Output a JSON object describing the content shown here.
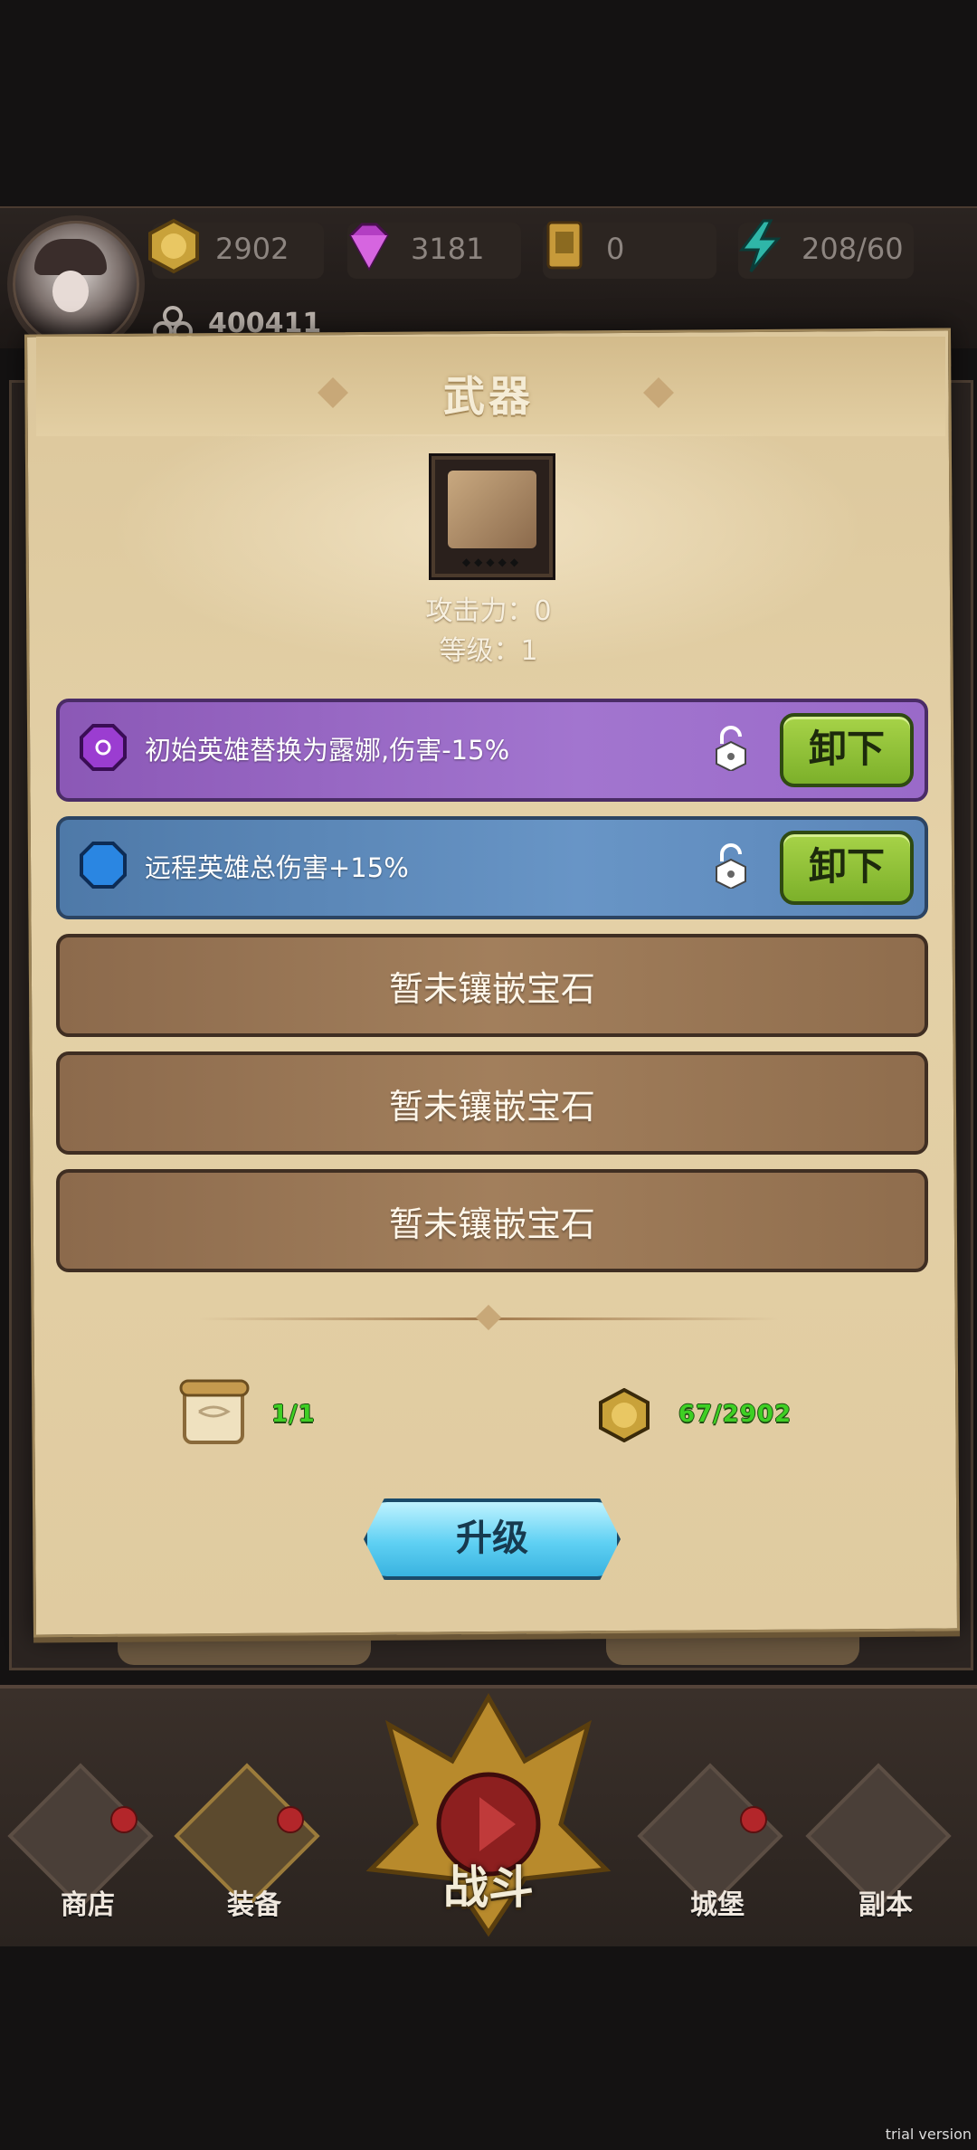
{
  "resources": {
    "gold": "2902",
    "gems": "3181",
    "tickets": "0",
    "energy": "208/60",
    "power": "400411"
  },
  "dialog": {
    "title": "武器",
    "attack": "攻击力：0",
    "level": "等级：1",
    "slots": [
      {
        "text": "初始英雄替换为露娜,伤害-15%",
        "button": "卸下",
        "color": "#a275cf"
      },
      {
        "text": "远程英雄总伤害+15%",
        "button": "卸下",
        "color": "#6895c6"
      },
      {
        "text": "暂未镶嵌宝石"
      },
      {
        "text": "暂未镶嵌宝石"
      },
      {
        "text": "暂未镶嵌宝石"
      }
    ],
    "scroll_cost": "1/1",
    "gold_cost": "67/2902",
    "upgrade_label": "升级"
  },
  "nav": {
    "shop": "商店",
    "equip": "装备",
    "battle": "战斗",
    "castle": "城堡",
    "dungeon": "副本"
  },
  "watermark": "trial version"
}
